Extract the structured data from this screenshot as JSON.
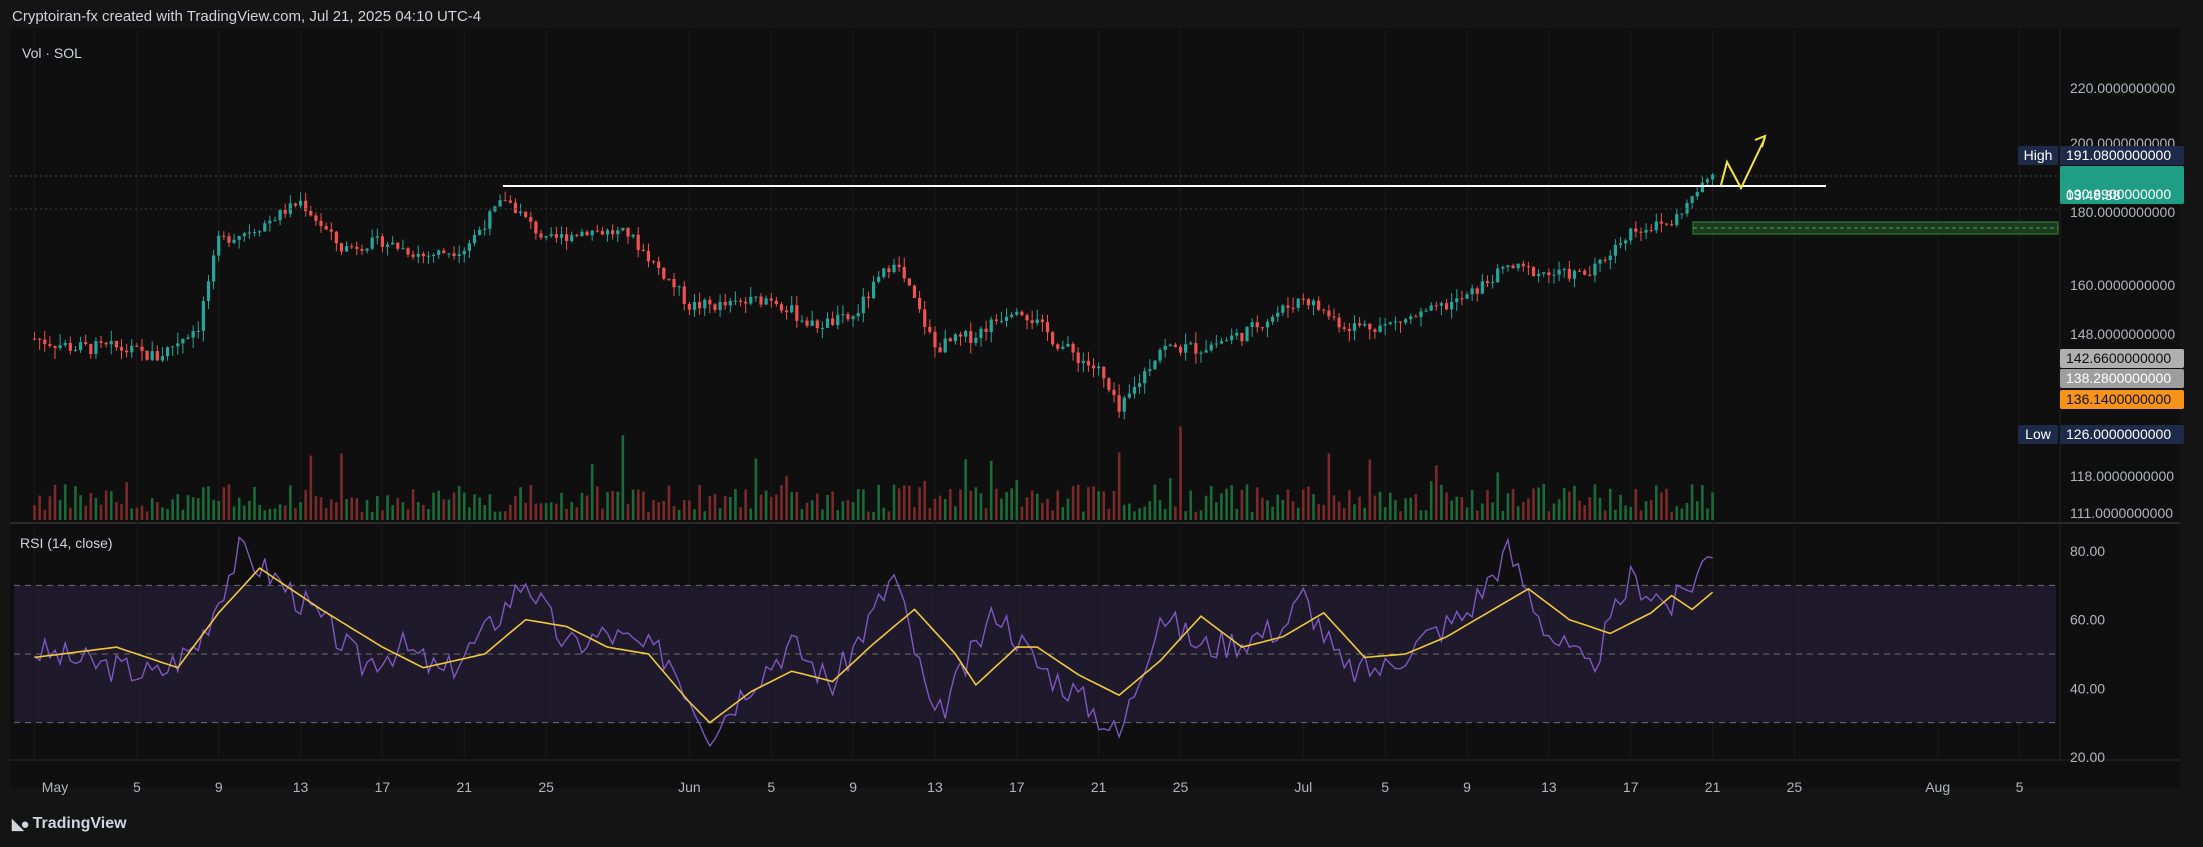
{
  "header": {
    "attribution": "Cryptoiran-fx created with TradingView.com, Jul 21, 2025 04:10 UTC-4"
  },
  "footer": {
    "logo_text": "TradingView"
  },
  "colors": {
    "up": "#26a69a",
    "down": "#ef5350",
    "vol_up": "#1b6b3a",
    "vol_down": "#7a2a2a",
    "rsi": "#7e57c2",
    "rsi_ma": "#f0c93a",
    "band": "#2a2238",
    "resistance": "#ffffff",
    "arrow": "#f5e642",
    "zone": "#2e7d32",
    "high_label": "#1e2a4a",
    "price_label": "#1f9e85",
    "grey_label": "#9e9e9e",
    "orange_label": "#f7931a"
  },
  "chart_data": [
    {
      "type": "candlestick",
      "legend": "Vol · SOL",
      "x_ticks": [
        "May",
        "5",
        "9",
        "13",
        "17",
        "21",
        "25",
        "Jun",
        "5",
        "9",
        "13",
        "17",
        "21",
        "25",
        "Jul",
        "5",
        "9",
        "13",
        "17",
        "21",
        "25",
        "Aug",
        "5"
      ],
      "y_ticks": [
        "220.0000000000",
        "200.0000000000",
        "180.0000000000",
        "160.0000000000",
        "148.0000000000",
        "118.0000000000",
        "111.0000000000"
      ],
      "price_path": [
        [
          "Apr 30",
          147
        ],
        [
          "May 2",
          145
        ],
        [
          "May 4",
          145
        ],
        [
          "May 6",
          143
        ],
        [
          "May 8",
          150
        ],
        [
          "May 9",
          172
        ],
        [
          "May 11",
          176
        ],
        [
          "May 13",
          183
        ],
        [
          "May 15",
          170
        ],
        [
          "May 17",
          172
        ],
        [
          "May 19",
          168
        ],
        [
          "May 21",
          170
        ],
        [
          "May 23",
          184
        ],
        [
          "May 25",
          172
        ],
        [
          "May 27",
          175
        ],
        [
          "May 29",
          174
        ],
        [
          "Jun 1",
          155
        ],
        [
          "Jun 3",
          155
        ],
        [
          "Jun 5",
          157
        ],
        [
          "Jun 7",
          150
        ],
        [
          "Jun 9",
          152
        ],
        [
          "Jun 11",
          167
        ],
        [
          "Jun 13",
          145
        ],
        [
          "Jun 15",
          148
        ],
        [
          "Jun 17",
          155
        ],
        [
          "Jun 19",
          146
        ],
        [
          "Jun 21",
          140
        ],
        [
          "Jun 22",
          131
        ],
        [
          "Jun 24",
          145
        ],
        [
          "Jun 26",
          145
        ],
        [
          "Jun 28",
          148
        ],
        [
          "Jul 1",
          157
        ],
        [
          "Jul 3",
          150
        ],
        [
          "Jul 5",
          150
        ],
        [
          "Jul 7",
          153
        ],
        [
          "Jul 9",
          157
        ],
        [
          "Jul 11",
          165
        ],
        [
          "Jul 13",
          163
        ],
        [
          "Jul 15",
          163
        ],
        [
          "Jul 17",
          175
        ],
        [
          "Jul 19",
          177
        ],
        [
          "Jul 21",
          191
        ]
      ],
      "resistance_level": 188,
      "support_zone": [
        173,
        177
      ],
      "projection_path": [
        [
          "Jul 21",
          191
        ],
        [
          "Jul 22",
          203
        ],
        [
          "Jul 23",
          188
        ],
        [
          "Jul 25",
          212
        ]
      ],
      "price_labels": [
        {
          "label": "High",
          "value": "191.0800000000"
        },
        {
          "value": "190.8900000000",
          "countdown": "03:49:38"
        },
        {
          "value": "142.6600000000"
        },
        {
          "value": "138.2800000000"
        },
        {
          "value": "136.1400000000"
        },
        {
          "label": "Low",
          "value": "126.0000000000"
        }
      ]
    },
    {
      "type": "line",
      "legend": "RSI (14, close)",
      "y_ticks": [
        "80.00",
        "60.00",
        "40.00",
        "20.00"
      ],
      "ylim": [
        14,
        86
      ],
      "bands": [
        30,
        50,
        70
      ],
      "rsi_path": [
        [
          "Apr 30",
          51
        ],
        [
          "May 3",
          47
        ],
        [
          "May 6",
          44
        ],
        [
          "May 8",
          53
        ],
        [
          "May 10",
          80
        ],
        [
          "May 12",
          71
        ],
        [
          "May 14",
          60
        ],
        [
          "May 16",
          47
        ],
        [
          "May 18",
          52
        ],
        [
          "May 20",
          44
        ],
        [
          "May 22",
          56
        ],
        [
          "May 24",
          72
        ],
        [
          "May 26",
          52
        ],
        [
          "May 28",
          56
        ],
        [
          "May 31",
          49
        ],
        [
          "Jun 2",
          27
        ],
        [
          "Jun 4",
          42
        ],
        [
          "Jun 6",
          53
        ],
        [
          "Jun 8",
          41
        ],
        [
          "Jun 10",
          62
        ],
        [
          "Jun 11",
          73
        ],
        [
          "Jun 13",
          30
        ],
        [
          "Jun 16",
          63
        ],
        [
          "Jun 18",
          47
        ],
        [
          "Jun 20",
          38
        ],
        [
          "Jun 22",
          26
        ],
        [
          "Jun 24",
          62
        ],
        [
          "Jun 26",
          52
        ],
        [
          "Jun 28",
          54
        ],
        [
          "Jun 30",
          58
        ],
        [
          "Jul 1",
          67
        ],
        [
          "Jul 3",
          45
        ],
        [
          "Jul 5",
          46
        ],
        [
          "Jul 7",
          55
        ],
        [
          "Jul 9",
          62
        ],
        [
          "Jul 11",
          80
        ],
        [
          "Jul 13",
          56
        ],
        [
          "Jul 15",
          45
        ],
        [
          "Jul 17",
          72
        ],
        [
          "Jul 19",
          64
        ],
        [
          "Jul 20",
          71
        ],
        [
          "Jul 21",
          81
        ]
      ],
      "rsi_ma_path": [
        [
          "Apr 30",
          49
        ],
        [
          "May 4",
          52
        ],
        [
          "May 7",
          46
        ],
        [
          "May 9",
          62
        ],
        [
          "May 11",
          75
        ],
        [
          "May 14",
          63
        ],
        [
          "May 17",
          52
        ],
        [
          "May 19",
          46
        ],
        [
          "May 22",
          50
        ],
        [
          "May 24",
          60
        ],
        [
          "May 26",
          58
        ],
        [
          "May 28",
          52
        ],
        [
          "May 30",
          50
        ],
        [
          "Jun 1",
          36
        ],
        [
          "Jun 2",
          30
        ],
        [
          "Jun 4",
          39
        ],
        [
          "Jun 6",
          45
        ],
        [
          "Jun 8",
          42
        ],
        [
          "Jun 10",
          53
        ],
        [
          "Jun 12",
          63
        ],
        [
          "Jun 14",
          50
        ],
        [
          "Jun 15",
          41
        ],
        [
          "Jun 17",
          52
        ],
        [
          "Jun 18",
          52
        ],
        [
          "Jun 20",
          44
        ],
        [
          "Jun 22",
          38
        ],
        [
          "Jun 24",
          48
        ],
        [
          "Jun 26",
          61
        ],
        [
          "Jun 28",
          52
        ],
        [
          "Jun 30",
          55
        ],
        [
          "Jul 2",
          62
        ],
        [
          "Jul 4",
          49
        ],
        [
          "Jul 6",
          50
        ],
        [
          "Jul 8",
          55
        ],
        [
          "Jul 10",
          62
        ],
        [
          "Jul 12",
          69
        ],
        [
          "Jul 14",
          60
        ],
        [
          "Jul 16",
          56
        ],
        [
          "Jul 18",
          62
        ],
        [
          "Jul 19",
          67
        ],
        [
          "Jul 20",
          63
        ],
        [
          "Jul 21",
          68
        ]
      ]
    }
  ]
}
